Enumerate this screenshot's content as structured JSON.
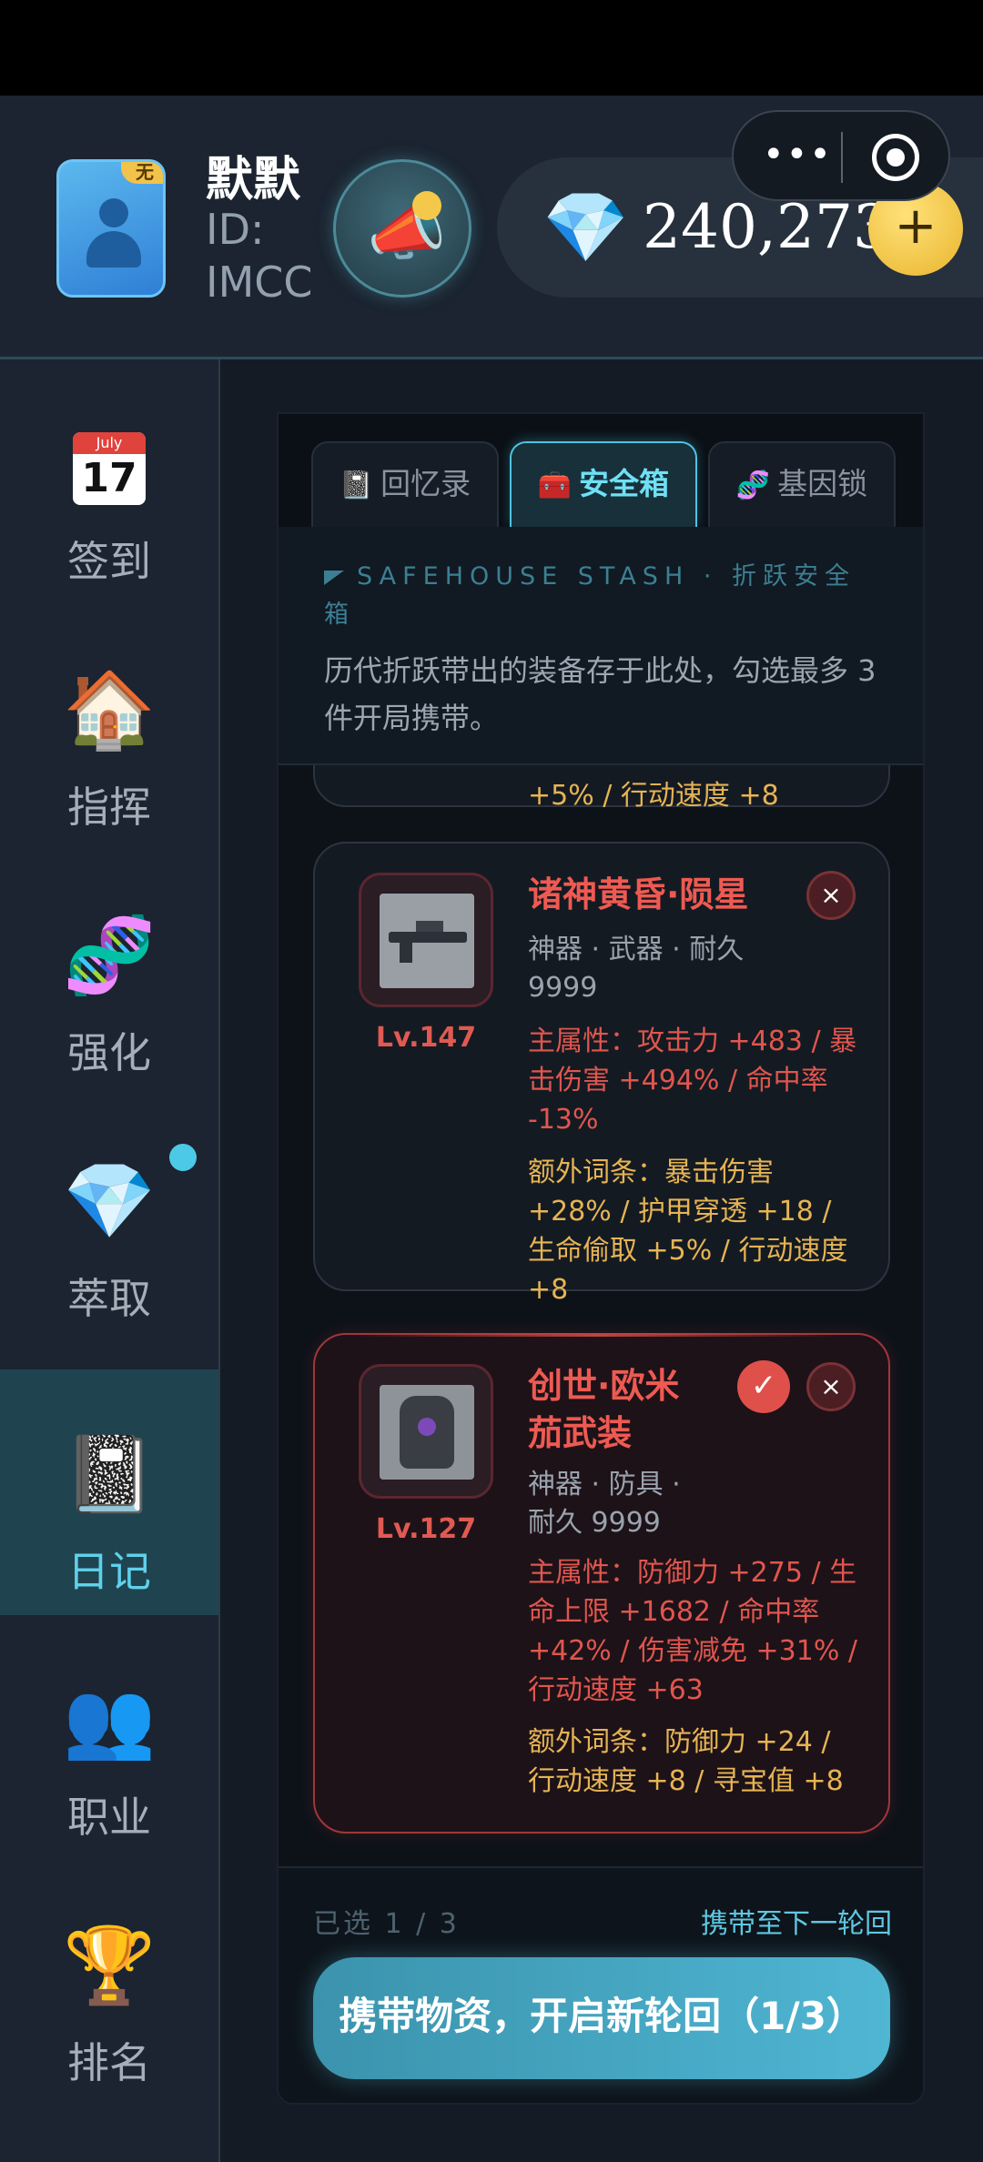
{
  "header": {
    "username": "默默",
    "user_id": "ID: IMCC",
    "avatar_badge": "无",
    "announce_icon": "megaphone-icon",
    "currency_icon": "diamond-icon",
    "balance": "240,273",
    "add_label": "+",
    "menu_more": "•••",
    "close_capsule_icon": "target-icon"
  },
  "sidebar": {
    "items": [
      {
        "label": "签到",
        "icon": "calendar-icon",
        "cal_month": "July",
        "cal_day": "17"
      },
      {
        "label": "指挥",
        "icon": "house-icon",
        "glyph": "🏠"
      },
      {
        "label": "强化",
        "icon": "dna-icon",
        "glyph": "🧬"
      },
      {
        "label": "萃取",
        "icon": "gem-icon",
        "glyph": "💎"
      },
      {
        "label": "日记",
        "icon": "notebook-icon",
        "glyph": "📓"
      },
      {
        "label": "职业",
        "icon": "users-icon",
        "glyph": "👥"
      },
      {
        "label": "排名",
        "icon": "trophy-icon",
        "glyph": "🏆"
      }
    ],
    "active_index": 4
  },
  "tabs": [
    {
      "label": "回忆录",
      "glyph": "📓"
    },
    {
      "label": "安全箱",
      "glyph": "🧰"
    },
    {
      "label": "基因锁",
      "glyph": "🧬"
    }
  ],
  "intro": {
    "title": "SAFEHOUSE STASH · 折跃安全箱",
    "description": "历代折跃带出的装备存于此处，勾选最多 3 件开局携带。"
  },
  "prev_card_tail": "+5% / 行动速度 +8",
  "items": [
    {
      "name": "诸神黄昏·陨星",
      "meta": "神器 · 武器 · 耐久 9999",
      "level": "Lv.147",
      "main_attr": "主属性：攻击力 +483 / 暴击伤害 +494% / 命中率 -13%",
      "extra_attr": "额外词条：暴击伤害 +28% / 护甲穿透 +18 / 生命偷取 +5% / 行动速度 +8",
      "selected": false
    },
    {
      "name": "创世·欧米茄武装",
      "meta": "神器 · 防具 · 耐久 9999",
      "level": "Lv.127",
      "main_attr": "主属性：防御力 +275 / 生命上限 +1682 / 命中率 +42% / 伤害减免 +31% / 行动速度 +63",
      "extra_attr": "额外词条：防御力 +24 / 行动速度 +8 / 寻宝值 +8",
      "selected": true
    }
  ],
  "footer": {
    "selected_count": "已选 1 / 3",
    "carry_hint": "携带至下一轮回",
    "cta_label": "携带物资，开启新轮回（1/3）"
  },
  "icons": {
    "remove": "×",
    "check": "✓"
  }
}
